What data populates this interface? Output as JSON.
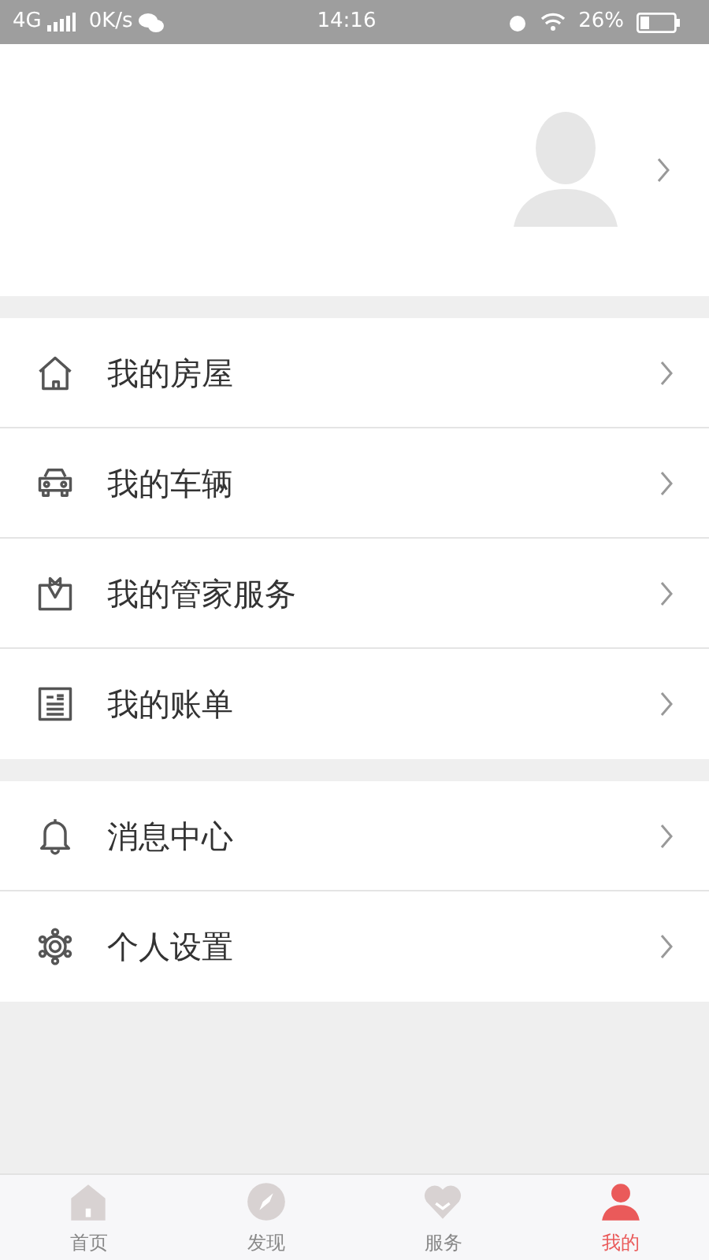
{
  "status_bar": {
    "network": "4G",
    "speed": "0K/s",
    "time": "14:16",
    "battery": "26%"
  },
  "menu_groups": [
    [
      {
        "kind": "house",
        "label": "我的房屋"
      },
      {
        "kind": "car",
        "label": "我的车辆"
      },
      {
        "kind": "butler",
        "label": "我的管家服务"
      },
      {
        "kind": "bill",
        "label": "我的账单"
      }
    ],
    [
      {
        "kind": "bell",
        "label": "消息中心"
      },
      {
        "kind": "gear",
        "label": "个人设置"
      }
    ]
  ],
  "tab_bar": [
    {
      "kind": "home",
      "label": "首页",
      "selected": false
    },
    {
      "kind": "discover",
      "label": "发现",
      "selected": false
    },
    {
      "kind": "service",
      "label": "服务",
      "selected": false
    },
    {
      "kind": "me",
      "label": "我的",
      "selected": true
    }
  ]
}
